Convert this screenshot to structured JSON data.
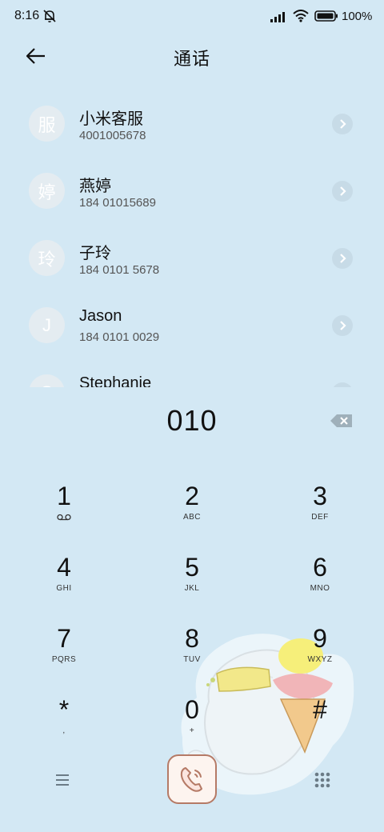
{
  "status": {
    "time": "8:16",
    "battery": "100%"
  },
  "header": {
    "title": "通话"
  },
  "contacts": [
    {
      "avatar": "服",
      "name": "小米客服",
      "number": "4001005678"
    },
    {
      "avatar": "婷",
      "name": "燕婷",
      "number": "184 01015689"
    },
    {
      "avatar": "玲",
      "name": "子玲",
      "number": "184 0101 5678"
    },
    {
      "avatar": "J",
      "name": "Jason",
      "number": "184 0101 0029"
    },
    {
      "avatar": "S",
      "name": "Stephanie",
      "number": ""
    }
  ],
  "dial": {
    "number": "010"
  },
  "keypad": [
    {
      "digit": "1",
      "letters": ""
    },
    {
      "digit": "2",
      "letters": "ABC"
    },
    {
      "digit": "3",
      "letters": "DEF"
    },
    {
      "digit": "4",
      "letters": "GHI"
    },
    {
      "digit": "5",
      "letters": "JKL"
    },
    {
      "digit": "6",
      "letters": "MNO"
    },
    {
      "digit": "7",
      "letters": "PQRS"
    },
    {
      "digit": "8",
      "letters": "TUV"
    },
    {
      "digit": "9",
      "letters": "WXYZ"
    },
    {
      "digit": "*",
      "letters": ","
    },
    {
      "digit": "0",
      "letters": "+"
    },
    {
      "digit": "#",
      "letters": ""
    }
  ],
  "icons": {
    "back": "arrow-left-icon",
    "delete": "backspace-icon",
    "menu": "menu-icon",
    "call": "phone-icon",
    "keypad": "dialpad-icon",
    "voicemail": "voicemail-icon"
  },
  "colors": {
    "background": "#d3e8f4",
    "call_button": "#b57a66"
  }
}
